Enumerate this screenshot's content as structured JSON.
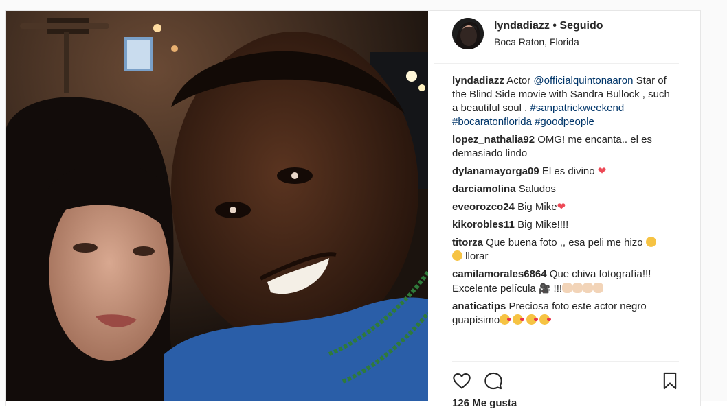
{
  "post": {
    "username": "lyndadiazz",
    "separator": "•",
    "follow_status": "Seguido",
    "location": "Boca Raton, Florida"
  },
  "caption": {
    "user": "lyndadiazz",
    "text_1": "Actor",
    "mention": "@officialquintonaaron",
    "text_2": "Star of the Blind Side movie with Sandra Bullock , such a beautiful soul .",
    "hashtags": [
      "#sanpatrickweekend",
      "#bocaratonflorida",
      "#goodpeople"
    ]
  },
  "comments": [
    {
      "user": "lopez_nathalia92",
      "text": "OMG! me encanta.. el es demasiado lindo"
    },
    {
      "user": "dylanamayorga09",
      "text": "El es divino",
      "emoji": "❤"
    },
    {
      "user": "darciamolina",
      "text": "Saludos"
    },
    {
      "user": "eveorozco24",
      "text": "Big Mike",
      "emoji": "❤"
    },
    {
      "user": "kikorobles11",
      "text": "Big Mike!!!!"
    },
    {
      "user": "titorza",
      "text": "Que buena foto ,, esa peli me hizo",
      "text_2": "llorar"
    },
    {
      "user": "camilamorales6864",
      "text": "Que chiva fotografía!!! Excelente película",
      "text_2": "!!!"
    },
    {
      "user": "anaticatips",
      "text": "Preciosa foto este actor negro guapísimo"
    }
  ],
  "likes_text": "126 Me gusta",
  "icons": [
    "heart-icon",
    "comment-icon",
    "bookmark-icon"
  ],
  "colors": {
    "link": "#003569",
    "heart": "#ed4956",
    "text": "#262626"
  }
}
